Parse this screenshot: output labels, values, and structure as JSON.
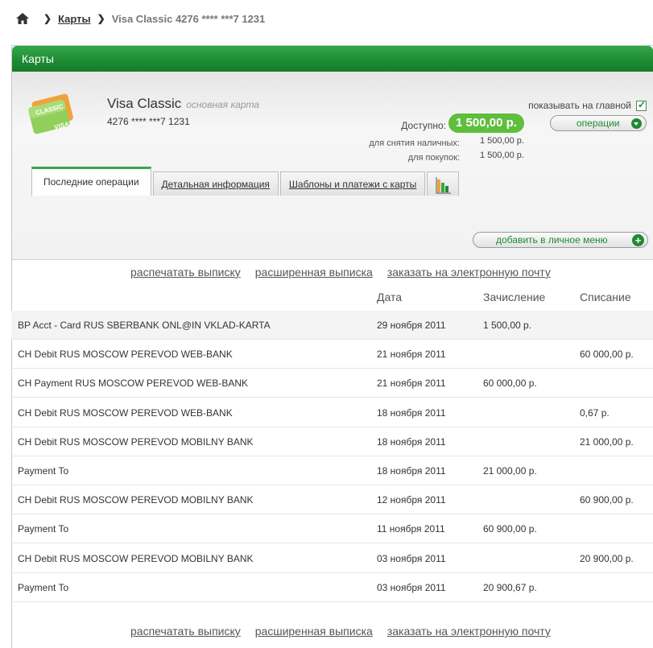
{
  "breadcrumb": {
    "cards_link": "Карты",
    "current": "Visa Classic 4276 **** ***7 1231"
  },
  "panel": {
    "title": "Карты"
  },
  "card": {
    "name": "Visa Classic",
    "subtitle": "основная карта",
    "number": "4276 **** ***7 1231",
    "image_text_top": "CLASSIC",
    "image_text_bottom": "VISA",
    "show_on_main_label": "показывать на главной",
    "show_on_main_checked": true,
    "available_label": "Доступно:",
    "available_value": "1 500,00 р.",
    "operations_button": "операции",
    "cash_label": "для снятия наличных:",
    "cash_value": "1 500,00 р.",
    "purchase_label": "для покупок:",
    "purchase_value": "1 500,00 р."
  },
  "tabs": [
    {
      "label": "Последние операции",
      "active": true
    },
    {
      "label": "Детальная информация",
      "active": false
    },
    {
      "label": "Шаблоны и платежи с карты",
      "active": false
    }
  ],
  "actions": {
    "add_to_menu": "добавить в личное меню",
    "print": "распечатать выписку",
    "extended": "расширенная выписка",
    "email": "заказать на электронную почту"
  },
  "table": {
    "columns": {
      "date": "Дата",
      "credit": "Зачисление",
      "debit": "Списание"
    },
    "rows": [
      {
        "desc": "BP Acct - Card RUS SBERBANK ONL@IN VKLAD-KARTA",
        "date": "29 ноября 2011",
        "credit": "1 500,00 р.",
        "debit": ""
      },
      {
        "desc": "CH Debit RUS MOSCOW PEREVOD WEB-BANK",
        "date": "21 ноября 2011",
        "credit": "",
        "debit": "60 000,00 р."
      },
      {
        "desc": "CH Payment RUS MOSCOW PEREVOD WEB-BANK",
        "date": "21 ноября 2011",
        "credit": "60 000,00 р.",
        "debit": ""
      },
      {
        "desc": "CH Debit RUS MOSCOW PEREVOD WEB-BANK",
        "date": "18 ноября 2011",
        "credit": "",
        "debit": "0,67 р."
      },
      {
        "desc": "CH Debit RUS MOSCOW PEREVOD MOBILNY BANK",
        "date": "18 ноября 2011",
        "credit": "",
        "debit": "21 000,00 р."
      },
      {
        "desc": "Payment To",
        "date": "18 ноября 2011",
        "credit": "21 000,00 р.",
        "debit": ""
      },
      {
        "desc": "CH Debit RUS MOSCOW PEREVOD MOBILNY BANK",
        "date": "12 ноября 2011",
        "credit": "",
        "debit": "60 900,00 р."
      },
      {
        "desc": "Payment To",
        "date": "11 ноября 2011",
        "credit": "60 900,00 р.",
        "debit": ""
      },
      {
        "desc": "CH Debit RUS MOSCOW PEREVOD MOBILNY BANK",
        "date": "03 ноября 2011",
        "credit": "",
        "debit": "20 900,00 р."
      },
      {
        "desc": "Payment To",
        "date": "03 ноября 2011",
        "credit": "20 900,67 р.",
        "debit": ""
      }
    ]
  },
  "colors": {
    "brand_green": "#1e8a33",
    "badge_green": "#5fbe3c"
  }
}
